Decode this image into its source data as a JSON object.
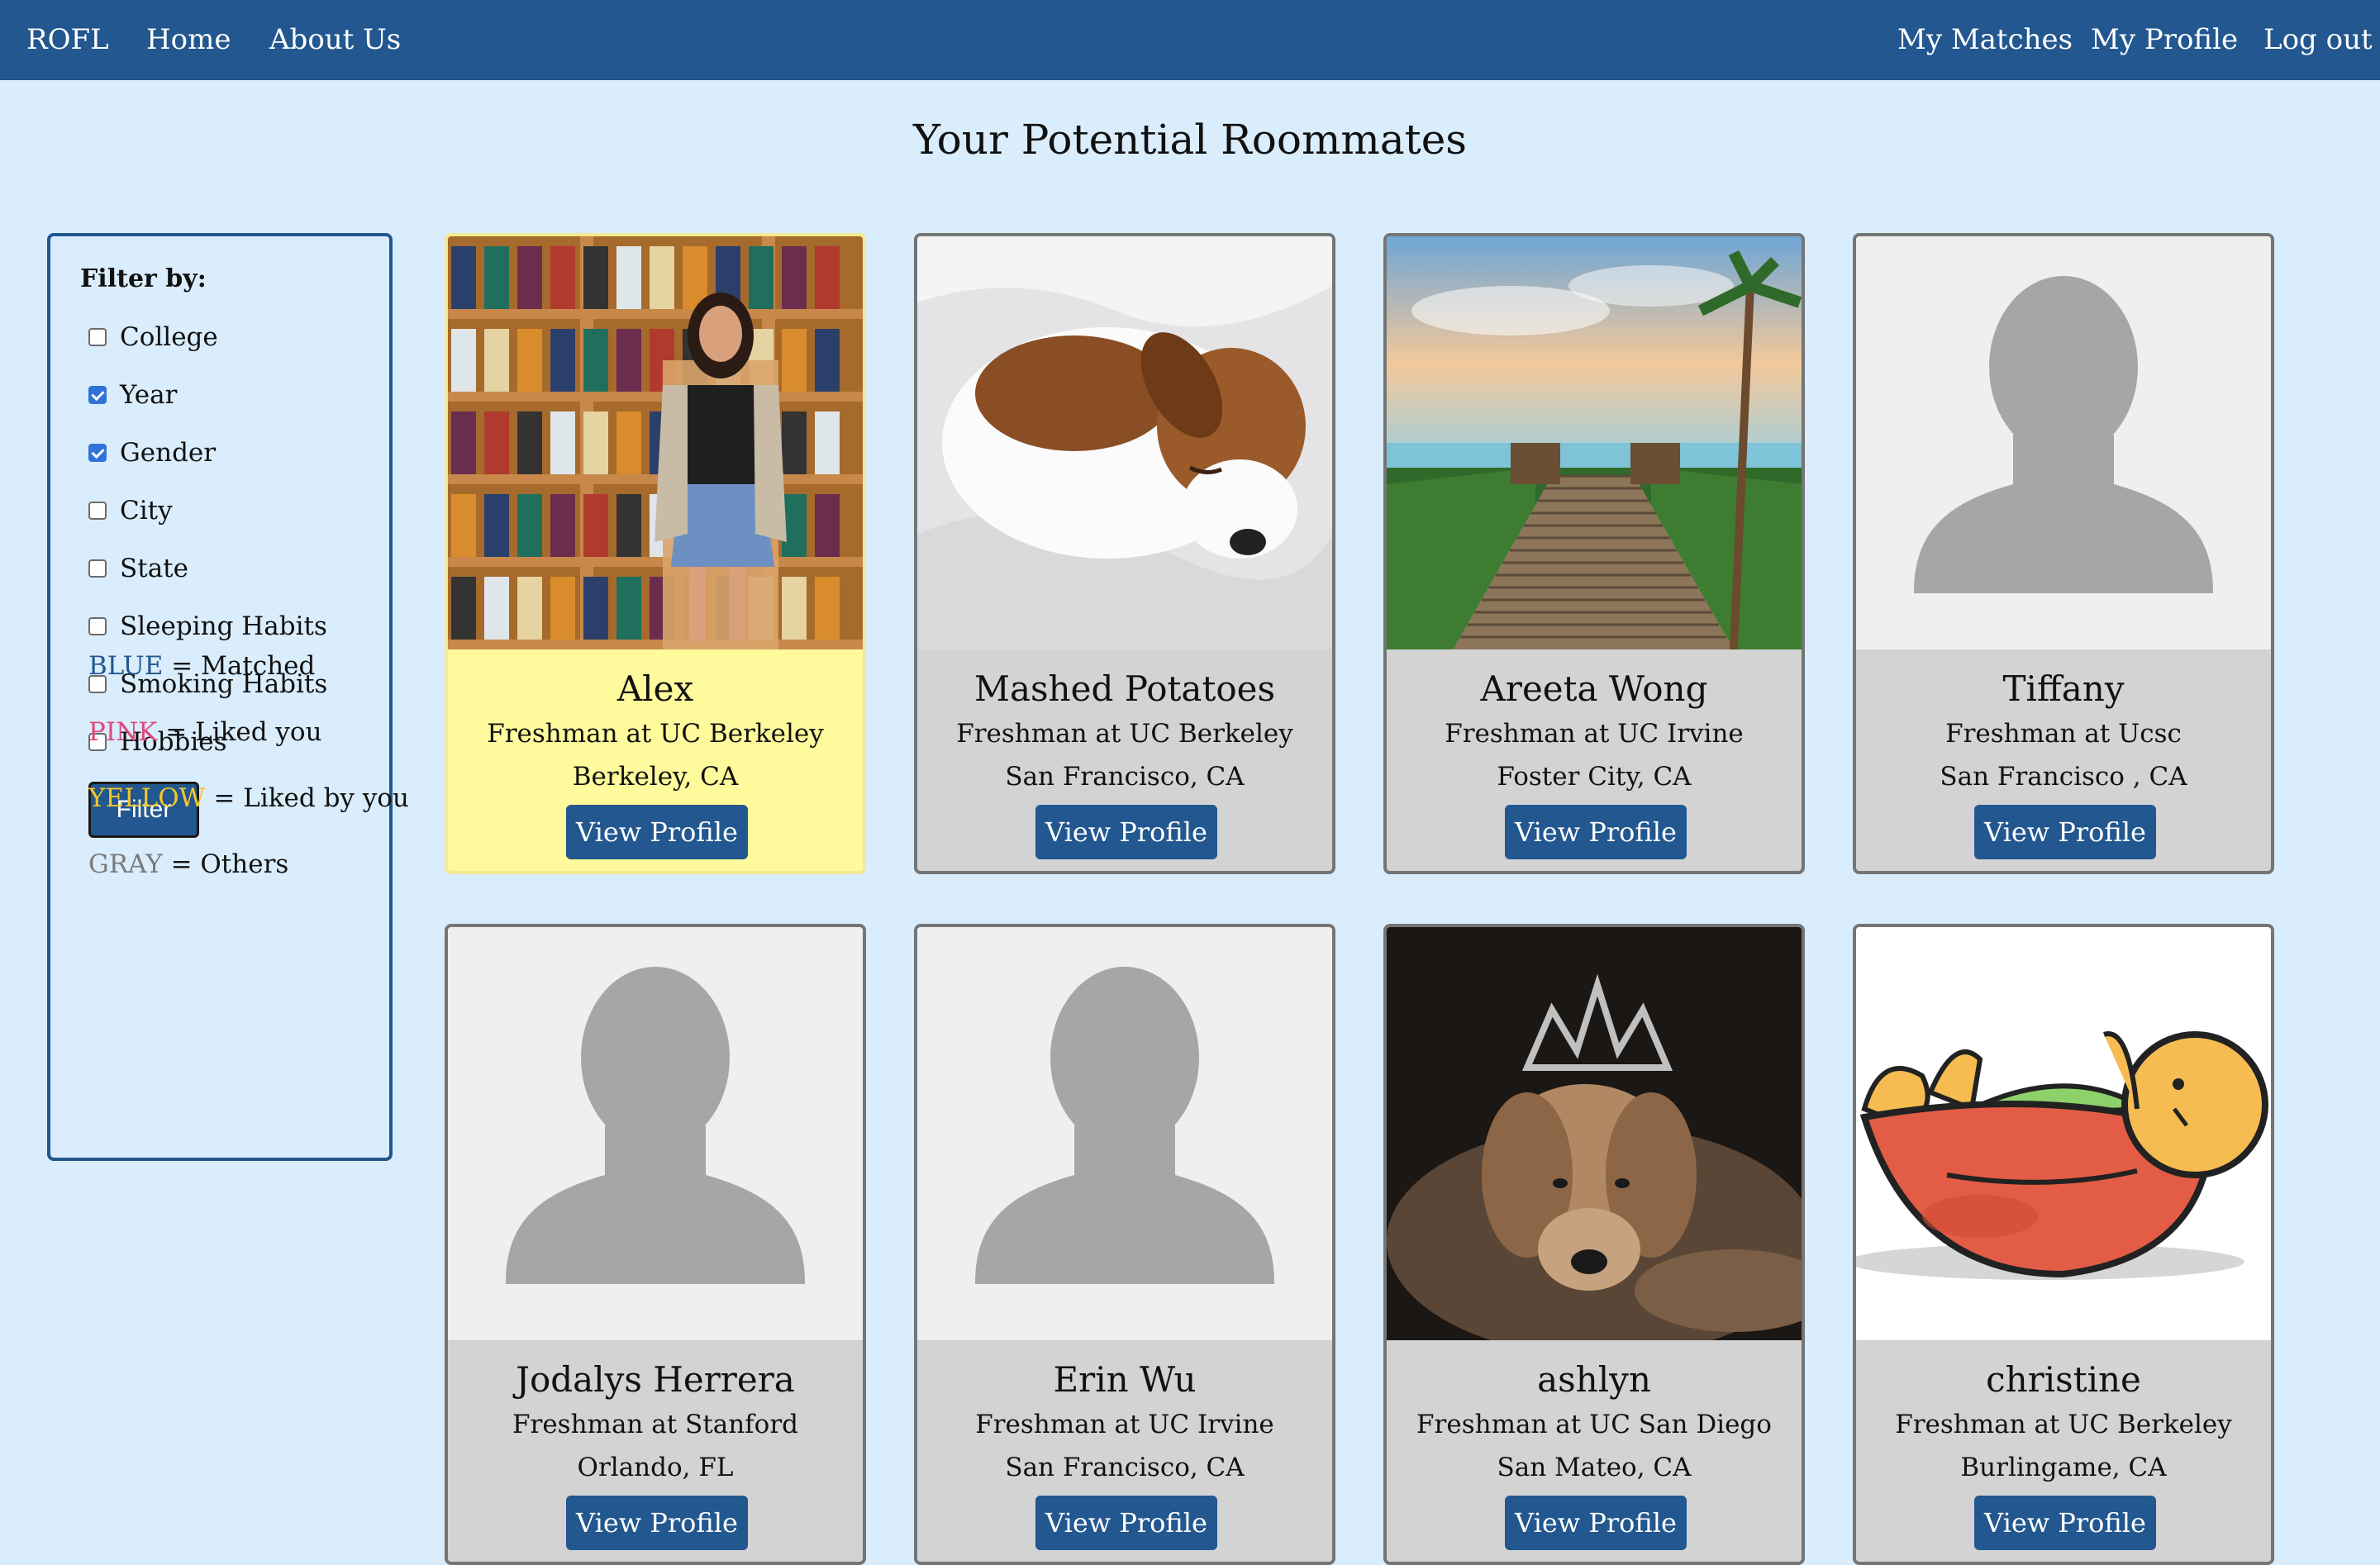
{
  "nav": {
    "brand": "ROFL",
    "home": "Home",
    "about": "About Us",
    "matches": "My Matches",
    "profile": "My Profile",
    "logout": "Log out"
  },
  "page_title": "Your Potential Roommates",
  "filter": {
    "heading": "Filter by:",
    "options": [
      {
        "label": "College",
        "checked": false
      },
      {
        "label": "Year",
        "checked": true
      },
      {
        "label": "Gender",
        "checked": true
      },
      {
        "label": "City",
        "checked": false
      },
      {
        "label": "State",
        "checked": false
      },
      {
        "label": "Sleeping Habits",
        "checked": false
      },
      {
        "label": "Smoking Habits",
        "checked": false
      },
      {
        "label": "Hobbies",
        "checked": false
      }
    ],
    "button": "Filter"
  },
  "legend": [
    {
      "color_word": "BLUE",
      "rest": "= Matched",
      "color": "#22578f"
    },
    {
      "color_word": "PINK",
      "rest": "= Liked you",
      "color": "#e0497a"
    },
    {
      "color_word": "YELLOW",
      "rest": "= Liked by you",
      "color": "#f4c62c"
    },
    {
      "color_word": "GRAY",
      "rest": "= Others",
      "color": "#7a7a7a"
    }
  ],
  "colors": {
    "nav": "#22578f",
    "background": "#daedfc",
    "card_gray": "#d3d3d3",
    "card_yellow": "#fffa9b"
  },
  "cards": [
    {
      "name": "Alex",
      "school": "Freshman at UC Berkeley",
      "location": "Berkeley, CA",
      "button": "View Profile",
      "status": "liked-by-you",
      "photo": "woman-bookshelf-photo"
    },
    {
      "name": "Mashed Potatoes",
      "school": "Freshman at UC Berkeley",
      "location": "San Francisco, CA",
      "button": "View Profile",
      "status": "other",
      "photo": "sleeping-puppy-photo"
    },
    {
      "name": "Areeta Wong",
      "school": "Freshman at UC Irvine",
      "location": "Foster City, CA",
      "button": "View Profile",
      "status": "other",
      "photo": "beach-boardwalk-photo"
    },
    {
      "name": "Tiffany",
      "school": "Freshman at Ucsc",
      "location": "San Francisco , CA",
      "button": "View Profile",
      "status": "other",
      "photo": "default-avatar"
    },
    {
      "name": "Jodalys Herrera",
      "school": "Freshman at Stanford",
      "location": "Orlando, FL",
      "button": "View Profile",
      "status": "other",
      "photo": "default-avatar"
    },
    {
      "name": "Erin Wu",
      "school": "Freshman at UC Irvine",
      "location": "San Francisco, CA",
      "button": "View Profile",
      "status": "other",
      "photo": "default-avatar"
    },
    {
      "name": "ashlyn",
      "school": "Freshman at UC San Diego",
      "location": "San Mateo, CA",
      "button": "View Profile",
      "status": "other",
      "photo": "dog-tiara-photo"
    },
    {
      "name": "christine",
      "school": "Freshman at UC Berkeley",
      "location": "Burlingame, CA",
      "button": "View Profile",
      "status": "other",
      "photo": "cartoon-bowl-photo"
    }
  ]
}
